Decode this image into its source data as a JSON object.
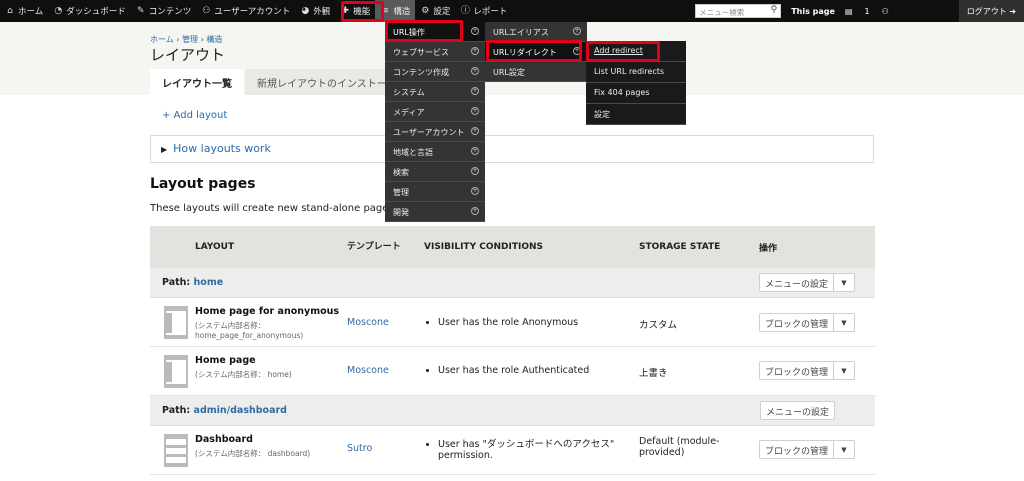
{
  "toolbar": {
    "items": [
      {
        "label": "ホーム",
        "icon": "home-icon"
      },
      {
        "label": "ダッシュボード",
        "icon": "dashboard-icon"
      },
      {
        "label": "コンテンツ",
        "icon": "pencil-icon"
      },
      {
        "label": "ユーザーアカウント",
        "icon": "users-icon"
      },
      {
        "label": "外観",
        "icon": "palette-icon"
      },
      {
        "label": "機能",
        "icon": "puzzle-icon"
      },
      {
        "label": "構造",
        "icon": "structure-icon"
      },
      {
        "label": "設定",
        "icon": "wrench-icon"
      },
      {
        "label": "レポート",
        "icon": "info-icon"
      }
    ],
    "search_placeholder": "メニュー検索",
    "this_page": "This page",
    "count": "1",
    "logout": "ログアウト"
  },
  "breadcrumb": {
    "home": "ホーム",
    "sep": "›",
    "admin": "管理",
    "structure": "構造"
  },
  "page_title": "レイアウト",
  "tabs": [
    "レイアウト一覧",
    "新規レイアウトのインストール"
  ],
  "add_layout": "+ Add layout",
  "details_summary": "How layouts work",
  "section_title": "Layout pages",
  "section_desc": "These layouts will create new stand-alone pages or",
  "table": {
    "headers": {
      "layout": "LAYOUT",
      "template": "テンプレート",
      "visibility": "VISIBILITY CONDITIONS",
      "storage": "STORAGE STATE",
      "ops": "操作"
    },
    "paths": [
      {
        "prefix": "Path: ",
        "value": "home",
        "button": "メニューの設定"
      },
      {
        "prefix": "Path: ",
        "value": "admin/dashboard",
        "button": "メニューの設定"
      }
    ],
    "rows": [
      {
        "title": "Home page for anonymous",
        "sub1": "(システム内部名称：",
        "sub2": "home_page_for_anonymous)",
        "template": "Moscone",
        "visibility": "User has the role Anonymous",
        "storage": "カスタム",
        "button": "ブロックの管理"
      },
      {
        "title": "Home page",
        "sub1": "(システム内部名称： home)",
        "template": "Moscone",
        "visibility": "User has the role Authenticated",
        "storage": "上書き",
        "button": "ブロックの管理"
      },
      {
        "title": "Dashboard",
        "sub1": "(システム内部名称： dashboard)",
        "template": "Sutro",
        "visibility": "User has \"ダッシュボードへのアクセス\"",
        "visibility2": "permission.",
        "storage": "Default (module-",
        "storage2": "provided)",
        "button": "ブロックの管理"
      }
    ]
  },
  "menu_level1": [
    "URL操作",
    "ウェブサービス",
    "コンテンツ作成",
    "システム",
    "メディア",
    "ユーザーアカウント",
    "地域と言語",
    "検索",
    "管理",
    "開発"
  ],
  "menu_level2": [
    "URLエイリアス",
    "URLリダイレクト",
    "URL設定"
  ],
  "menu_level3": [
    "Add redirect",
    "List URL redirects",
    "Fix 404 pages",
    "設定"
  ],
  "highlight_color": "#e3001b"
}
